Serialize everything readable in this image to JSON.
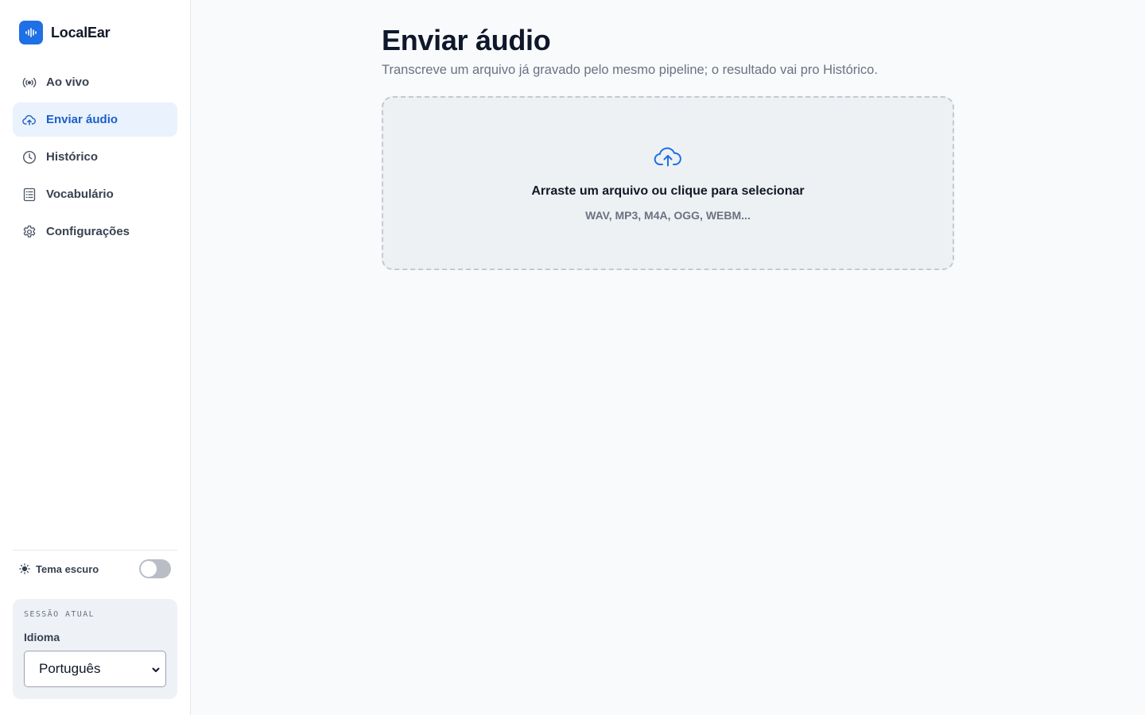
{
  "app": {
    "name": "LocalEar"
  },
  "sidebar": {
    "items": [
      {
        "label": "Ao vivo",
        "icon": "broadcast-icon",
        "active": false
      },
      {
        "label": "Enviar áudio",
        "icon": "cloud-upload-icon",
        "active": true
      },
      {
        "label": "Histórico",
        "icon": "clock-icon",
        "active": false
      },
      {
        "label": "Vocabulário",
        "icon": "list-icon",
        "active": false
      },
      {
        "label": "Configurações",
        "icon": "gear-icon",
        "active": false
      }
    ],
    "theme_toggle": {
      "label": "Tema escuro",
      "enabled": false
    },
    "session": {
      "title": "Sessão atual",
      "language_label": "Idioma",
      "language_value": "Português"
    }
  },
  "main": {
    "title": "Enviar áudio",
    "subtitle": "Transcreve um arquivo já gravado pelo mesmo pipeline; o resultado vai pro Histórico.",
    "dropzone": {
      "text": "Arraste um arquivo ou clique para selecionar",
      "formats": "WAV, MP3, M4A, OGG, WEBM..."
    }
  },
  "colors": {
    "accent": "#1f6fe5",
    "active_bg": "#eaf2fd",
    "active_text": "#1a5fc9",
    "background": "#f8fafc"
  }
}
